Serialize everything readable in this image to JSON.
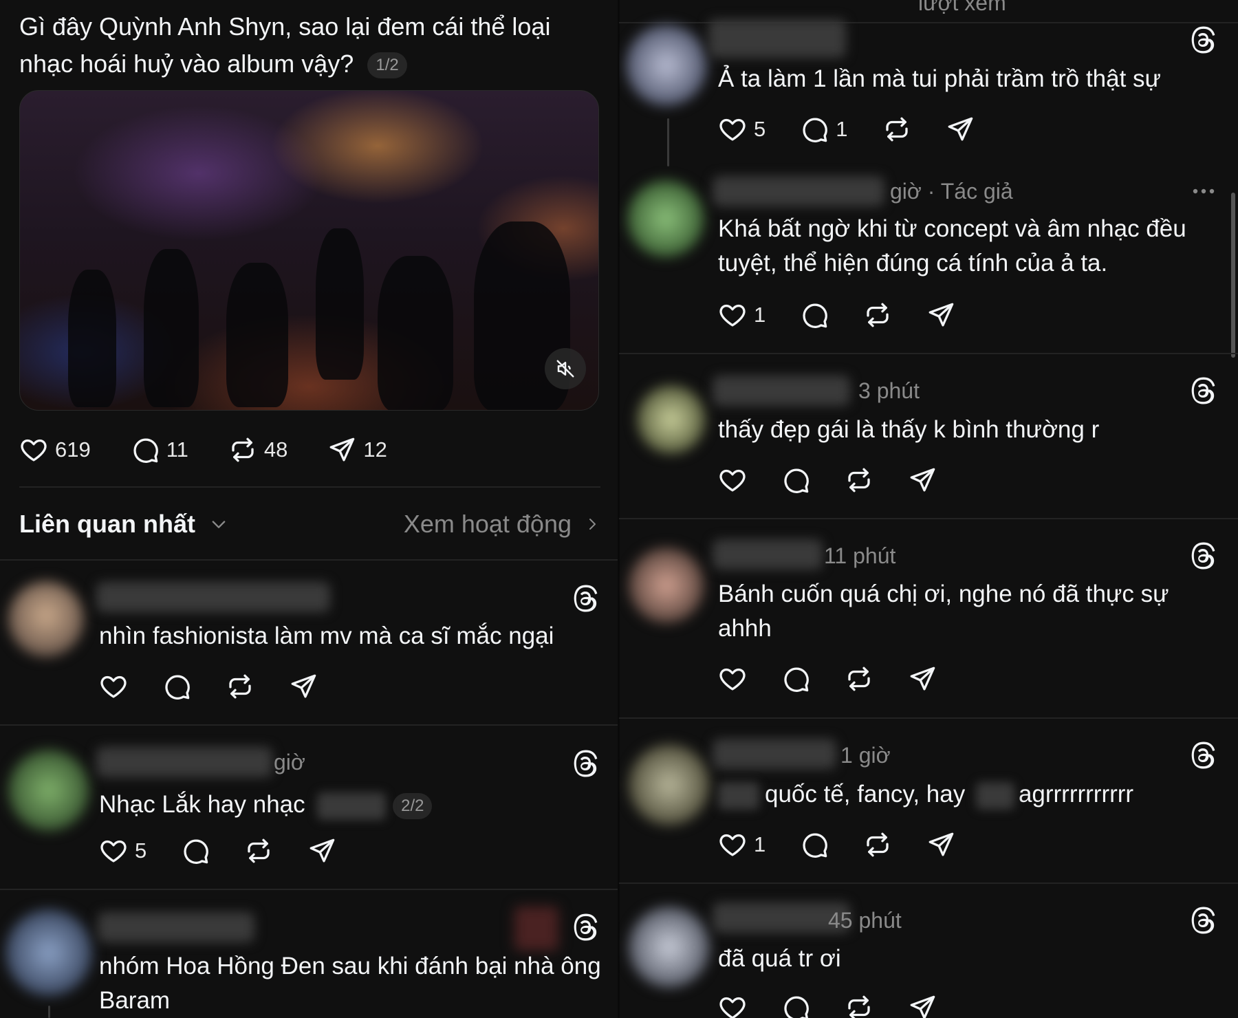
{
  "post": {
    "title": "Gì đây Quỳnh Anh Shyn, sao lại đem cái thể loại nhạc hoái huỷ vào album vậy?",
    "pager": "1/2",
    "likes": "619",
    "replies": "11",
    "reposts": "48",
    "shares": "12"
  },
  "sort": {
    "label": "Liên quan nhất",
    "activity_link": "Xem hoạt động"
  },
  "left_comments": [
    {
      "meta": "",
      "text": "nhìn fashionista làm mv mà ca sĩ mắc ngại",
      "likes": ""
    },
    {
      "meta": "giờ",
      "text": "Nhạc Lắk hay nhạc",
      "pager": "2/2",
      "likes": "5"
    },
    {
      "meta": "",
      "text": "nhóm Hoa Hồng Đen sau khi đánh bại nhà ông Baram",
      "likes": ""
    }
  ],
  "right_top": {
    "meta": "lượt xem"
  },
  "right_comments": [
    {
      "meta": "",
      "text": "Ả ta làm 1 lần mà tui phải trầm trồ thật sự",
      "likes": "5",
      "replies": "1"
    },
    {
      "meta": "giờ · Tác giả",
      "text": "Khá bất ngờ khi từ concept và âm nhạc đều tuyệt, thể hiện đúng cá tính của ả ta.",
      "likes": "1",
      "replies": ""
    },
    {
      "meta": "3 phút",
      "text": "thấy đẹp gái là thấy k bình thường r",
      "likes": "",
      "replies": ""
    },
    {
      "meta": "11 phút",
      "text": "Bánh cuốn quá chị ơi, nghe nó đã thực sự ahhh",
      "likes": "",
      "replies": ""
    },
    {
      "meta": "1 giờ",
      "text_a": "quốc tế, fancy, hay",
      "text_b": "agrrrrrrrrrrr",
      "likes": "1",
      "replies": ""
    },
    {
      "meta": "45 phút",
      "text": "đã quá tr ơi",
      "likes": "",
      "replies": ""
    }
  ],
  "icons": [
    "heart-icon",
    "reply-icon",
    "repost-icon",
    "share-icon",
    "threads-icon",
    "chevron-down-icon",
    "chevron-right-icon",
    "mute-icon",
    "more-icon"
  ],
  "colors": {
    "background": "#101010",
    "text": "#f3f5f7",
    "muted": "#8a8a8a",
    "divider": "#232323"
  }
}
